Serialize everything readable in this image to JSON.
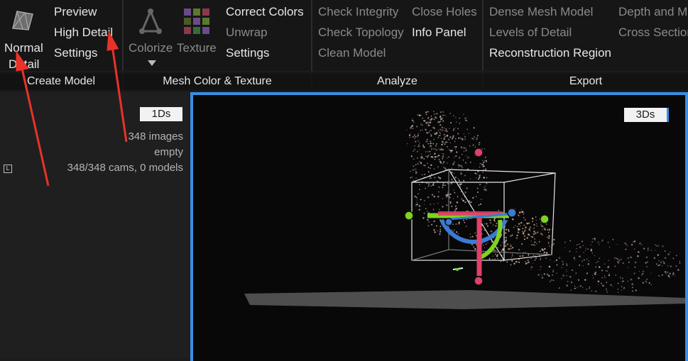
{
  "ribbon": {
    "create_model": {
      "normal_detail_line1": "Normal",
      "normal_detail_line2": "Detail",
      "preview": "Preview",
      "high_detail": "High Detail",
      "settings": "Settings",
      "group_label": "Create Model"
    },
    "mesh_color_texture": {
      "colorize": "Colorize",
      "texture": "Texture",
      "correct_colors": "Correct Colors",
      "unwrap": "Unwrap",
      "settings": "Settings",
      "group_label": "Mesh Color & Texture"
    },
    "analyze": {
      "check_integrity": "Check Integrity",
      "check_topology": "Check Topology",
      "clean_model": "Clean Model",
      "close_holes": "Close Holes",
      "info_panel": "Info Panel",
      "group_label": "Analyze"
    },
    "export": {
      "dense_mesh_model": "Dense Mesh Model",
      "levels_of_detail": "Levels of Detail",
      "reconstruction_region": "Reconstruction Region",
      "depth_and_mask": "Depth and M",
      "cross_sections": "Cross Section",
      "group_label": "Export"
    }
  },
  "left_panel": {
    "tab_1ds": "1Ds",
    "images": "348 images",
    "status": "empty",
    "cams": "348/348 cams, 0 models",
    "item_icon": "L"
  },
  "viewport": {
    "tab_3ds": "3Ds"
  },
  "colors": {
    "accent_blue": "#3a8ee6",
    "arrow_red": "#e8322a",
    "gizmo_red": "#e0406a",
    "gizmo_green": "#7ed321",
    "gizmo_blue": "#3a7bd5"
  }
}
